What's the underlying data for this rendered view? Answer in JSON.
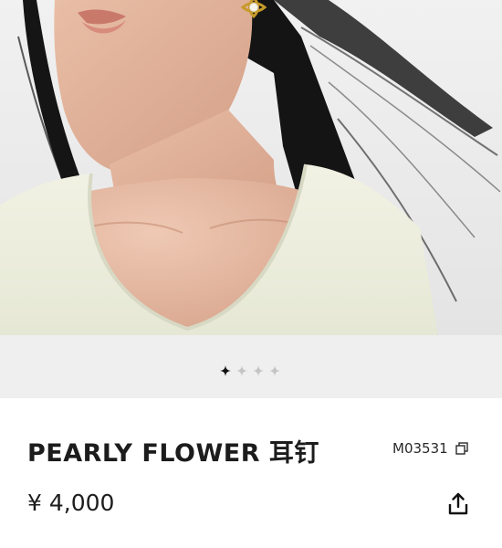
{
  "product": {
    "title": "PEARLY FLOWER 耳钉",
    "sku": "M03531",
    "price": "¥ 4,000"
  },
  "carousel": {
    "total": 4,
    "active_index": 0
  },
  "icons": {
    "copy": "copy-icon",
    "share": "share-icon",
    "active_dot": "sparkle-star-icon",
    "inactive_dot": "sparkle-star-icon"
  },
  "colors": {
    "text": "#1c1c1c",
    "carousel_background": "#efefef",
    "dot_active": "#111111",
    "dot_inactive": "#c4c4c4"
  }
}
